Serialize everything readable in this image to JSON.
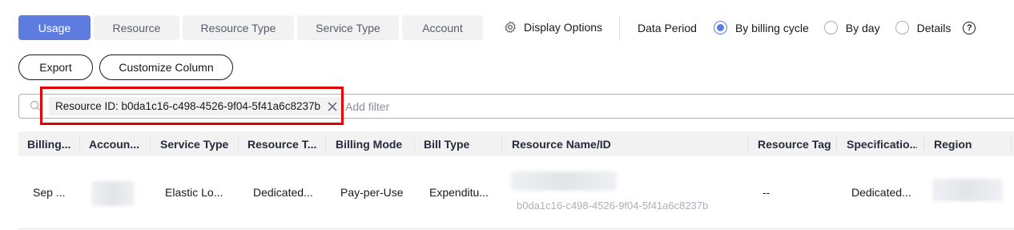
{
  "tabs": [
    {
      "label": "Usage",
      "active": true
    },
    {
      "label": "Resource",
      "active": false
    },
    {
      "label": "Resource Type",
      "active": false
    },
    {
      "label": "Service Type",
      "active": false
    },
    {
      "label": "Account",
      "active": false
    }
  ],
  "display_options": {
    "label": "Display Options",
    "icon": "gear-icon"
  },
  "data_period": {
    "label": "Data Period",
    "options": [
      {
        "label": "By billing cycle",
        "checked": true
      },
      {
        "label": "By day",
        "checked": false
      },
      {
        "label": "Details",
        "checked": false
      }
    ],
    "help_glyph": "?"
  },
  "buttons": {
    "export": "Export",
    "customize_column": "Customize Column"
  },
  "filter": {
    "chip_label": "Resource ID: b0da1c16-c498-4526-9f04-5f41a6c8237b",
    "add_filter": "Add filter"
  },
  "table": {
    "columns": [
      "Billing...",
      "Accoun...",
      "Service Type",
      "Resource T...",
      "Billing Mode",
      "Bill Type",
      "Resource Name/ID",
      "Resource Tag",
      "Specificatio...",
      "Region"
    ],
    "rows": [
      {
        "billing_cycle": "Sep ...",
        "account": "",
        "service_type": "Elastic Lo...",
        "resource_type": "Dedicated...",
        "billing_mode": "Pay-per-Use",
        "bill_type": "Expenditu...",
        "resource_name": "",
        "resource_id": "b0da1c16-c498-4526-9f04-5f41a6c8237b",
        "resource_tag": "--",
        "specification": "Dedicated...",
        "region": ""
      }
    ]
  },
  "colors": {
    "accent": "#5e7ce0",
    "highlight": "#e00000",
    "header_bg": "#f2f2f2"
  }
}
